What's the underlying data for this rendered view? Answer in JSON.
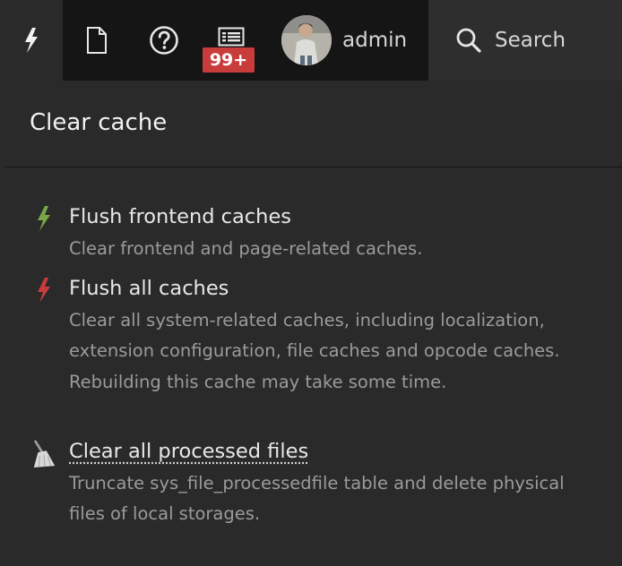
{
  "toolbar": {
    "badge_count": "99+",
    "user_name": "admin",
    "search_label": "Search"
  },
  "panel": {
    "title": "Clear cache",
    "items": [
      {
        "label": "Flush frontend caches",
        "description": "Clear frontend and page-related caches.",
        "icon": "lightning-green-icon",
        "icon_color": "#79a548"
      },
      {
        "label": "Flush all caches",
        "description": "Clear all system-related caches, including localization, extension configuration, file caches and opcode caches. Rebuilding this cache may take some time.",
        "icon": "lightning-red-icon",
        "icon_color": "#c83c3c"
      },
      {
        "label": "Clear all processed files",
        "description": "Truncate sys_file_processedfile table and delete physical files of local storages.",
        "icon": "broom-icon"
      }
    ]
  },
  "colors": {
    "topbar_bg": "#151515",
    "panel_bg": "#2a2a2a",
    "badge_bg": "#c83c3c"
  }
}
